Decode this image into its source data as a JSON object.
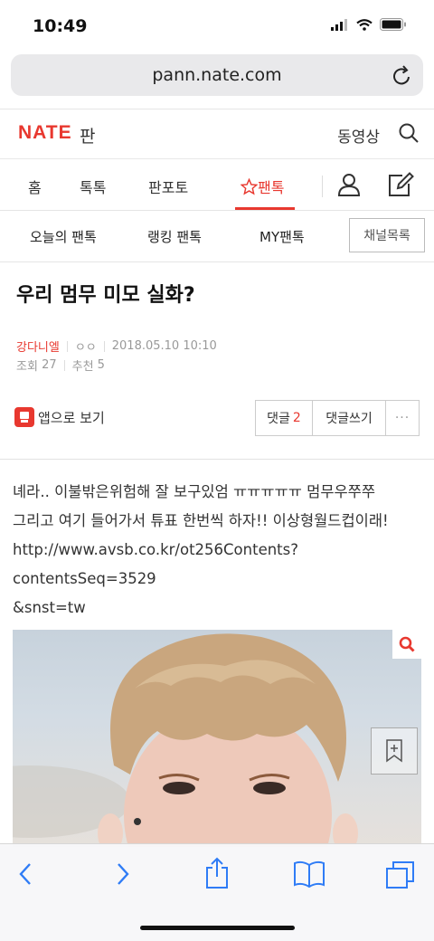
{
  "status_bar": {
    "time": "10:49"
  },
  "browser": {
    "url": "pann.nate.com"
  },
  "header": {
    "logo": "NATE",
    "logo_sub": "판",
    "video_link": "동영상"
  },
  "nav": {
    "items": [
      "홈",
      "톡톡",
      "판포토",
      "팬톡"
    ],
    "active_index": 3
  },
  "subnav": {
    "items": [
      "오늘의 팬톡",
      "랭킹 팬톡",
      "MY팬톡"
    ],
    "channel_list": "채널목록"
  },
  "post": {
    "title": "우리 멈무 미모 실화?",
    "author": "강다니엘",
    "author_extra": "ㅇㅇ",
    "date": "2018.05.10 10:10",
    "views_label": "조회",
    "views": "27",
    "recommend_label": "추천",
    "recommend": "5",
    "body_line1": "녜라.. 이불밖은위험해 잘 보구있엄 ㅠㅠㅠㅠㅠ 멈무우쭈쭈",
    "body_line2": "그리고 여기 들어가서 튜표 한번씩 하자!! 이상형월드컵이래!",
    "body_line3": "http://www.avsb.co.kr/ot256Contents?contentsSeq=3529",
    "body_line4": "&snst=tw"
  },
  "actions": {
    "app_view": "앱으로 보기",
    "comment_label": "댓글",
    "comment_count": "2",
    "write_comment": "댓글쓰기",
    "more": "···"
  },
  "colors": {
    "accent": "#e8382f"
  }
}
